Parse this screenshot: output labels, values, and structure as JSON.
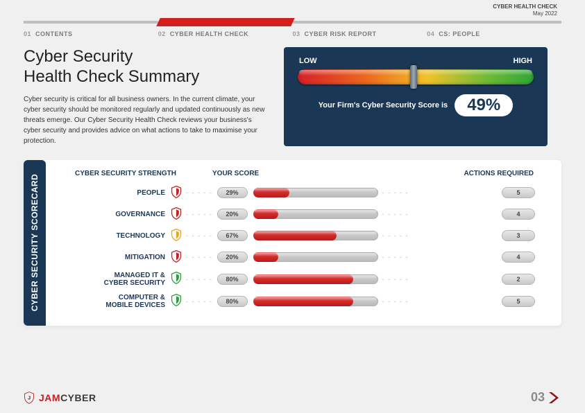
{
  "header": {
    "report_name": "CYBER HEALTH CHECK",
    "date": "May 2022"
  },
  "nav": [
    {
      "num": "01",
      "label": "CONTENTS"
    },
    {
      "num": "02",
      "label": "CYBER HEALTH CHECK"
    },
    {
      "num": "03",
      "label": "CYBER RISK REPORT"
    },
    {
      "num": "04",
      "label": "CS: PEOPLE"
    }
  ],
  "title_line1": "Cyber Security",
  "title_line2": "Health Check Summary",
  "description": "Cyber security is critical for all business owners. In the current climate, your cyber security should be monitored regularly and updated continuously as new threats emerge. Our Cyber Security Health Check reviews your business's cyber security and provides advice on what actions to take to maximise your protection.",
  "gauge": {
    "low_label": "LOW",
    "high_label": "HIGH",
    "score_text": "Your Firm's Cyber Security Score is",
    "score_value": "49%",
    "score_pct": 49
  },
  "scorecard": {
    "side_label": "CYBER SECURITY SCORECARD",
    "headers": {
      "strength": "CYBER SECURITY STRENGTH",
      "score": "YOUR SCORE",
      "actions": "ACTIONS REQUIRED"
    },
    "rows": [
      {
        "name": "PEOPLE",
        "score": "29%",
        "score_pct": 29,
        "actions": "5",
        "shield": "#c32121"
      },
      {
        "name": "GOVERNANCE",
        "score": "20%",
        "score_pct": 20,
        "actions": "4",
        "shield": "#c32121"
      },
      {
        "name": "TECHNOLOGY",
        "score": "67%",
        "score_pct": 67,
        "actions": "3",
        "shield": "#e9a51c"
      },
      {
        "name": "MITIGATION",
        "score": "20%",
        "score_pct": 20,
        "actions": "4",
        "shield": "#c32121"
      },
      {
        "name": "MANAGED IT &\nCYBER SECURITY",
        "score": "80%",
        "score_pct": 80,
        "actions": "2",
        "shield": "#2e9e3e"
      },
      {
        "name": "COMPUTER &\nMOBILE DEVICES",
        "score": "80%",
        "score_pct": 80,
        "actions": "5",
        "shield": "#2e9e3e"
      }
    ]
  },
  "footer": {
    "logo_j": "JAM",
    "logo_c": "CYBER",
    "page_num": "03"
  }
}
